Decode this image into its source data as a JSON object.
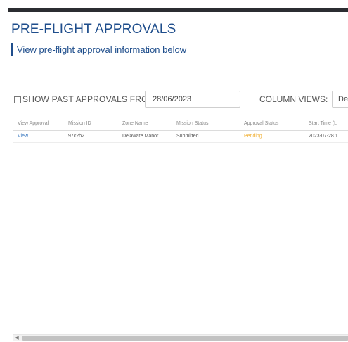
{
  "header": {
    "title": "PRE-FLIGHT APPROVALS",
    "subtitle": "View pre-flight approval information below"
  },
  "filters": {
    "show_past_label": "SHOW PAST APPROVALS FROM:",
    "show_past_checked": false,
    "date_value": "28/06/2023",
    "column_views_label": "COLUMN VIEWS:",
    "column_views_value": "De"
  },
  "table": {
    "columns": [
      "View Approval",
      "Mission ID",
      "Zone Name",
      "Mission Status",
      "Approval Status",
      "Start Time (L"
    ],
    "rows": [
      {
        "view": "View",
        "mission_id": "97c2b2",
        "zone_name": "Delaware Manor",
        "mission_status": "Submitted",
        "approval_status": "Pending",
        "start_time": "2023-07-28 1"
      }
    ]
  },
  "colors": {
    "accent": "#1f4e8c",
    "link": "#3b79c0",
    "pending": "#f0ad2c",
    "top_bar": "#2b2d31"
  },
  "icons": {
    "scroll_left": "scroll-left-icon"
  }
}
